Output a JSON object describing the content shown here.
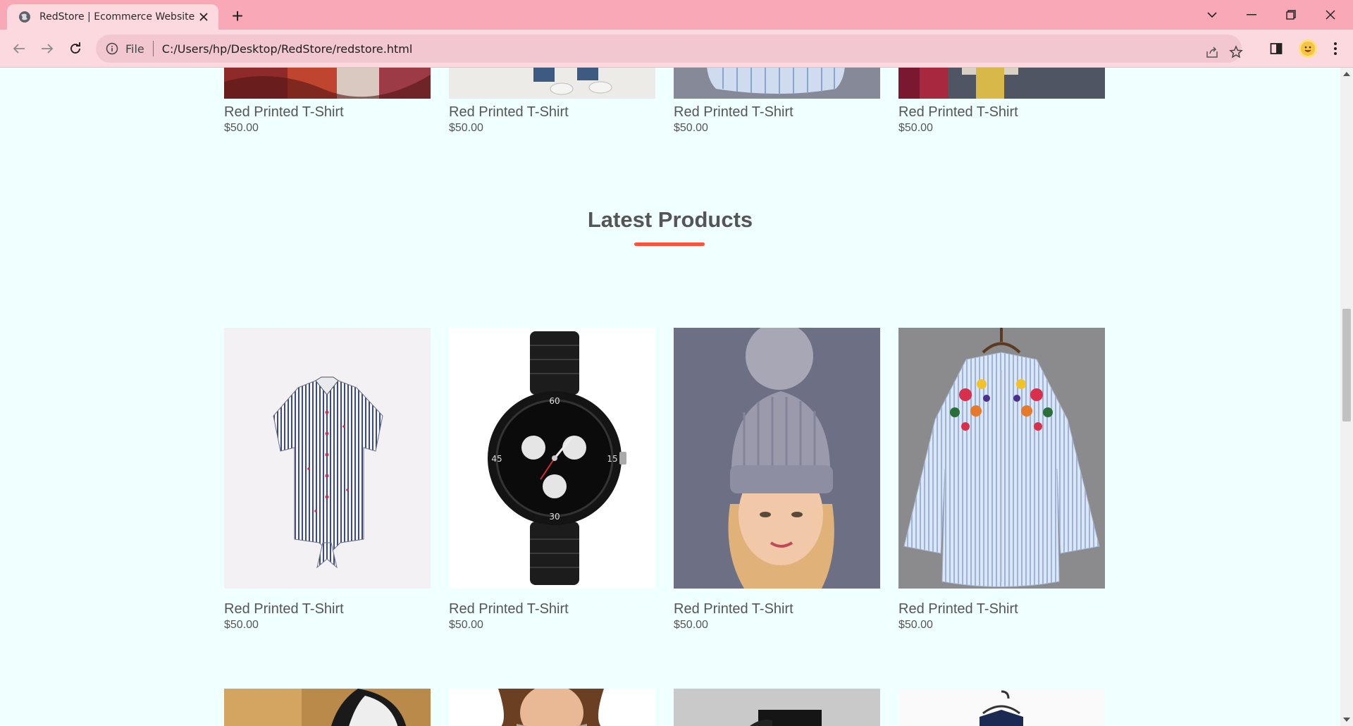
{
  "browser": {
    "tab_title": "RedStore | Ecommerce Website D",
    "new_tab_label": "+",
    "address_scheme": "File",
    "address_url": "C:/Users/hp/Desktop/RedStore/redstore.html"
  },
  "page": {
    "top_products": [
      {
        "title": "Red Printed T-Shirt",
        "price": "$50.00"
      },
      {
        "title": "Red Printed T-Shirt",
        "price": "$50.00"
      },
      {
        "title": "Red Printed T-Shirt",
        "price": "$50.00"
      },
      {
        "title": "Red Printed T-Shirt",
        "price": "$50.00"
      }
    ],
    "latest_title": "Latest Products",
    "latest_products": [
      {
        "title": "Red Printed T-Shirt",
        "price": "$50.00"
      },
      {
        "title": "Red Printed T-Shirt",
        "price": "$50.00"
      },
      {
        "title": "Red Printed T-Shirt",
        "price": "$50.00"
      },
      {
        "title": "Red Printed T-Shirt",
        "price": "$50.00"
      }
    ]
  },
  "colors": {
    "page_bg": "#f0ffff",
    "accent": "#ff523b",
    "browser_frame": "#f9a8b8",
    "browser_toolbar": "#fbd9df"
  },
  "icons": [
    "globe-icon",
    "close-icon",
    "plus-icon",
    "back-icon",
    "forward-icon",
    "reload-icon",
    "info-icon",
    "share-icon",
    "star-icon",
    "sidebar-icon",
    "profile-avatar-icon",
    "menu-icon",
    "chevron-down-icon",
    "minimize-icon",
    "restore-icon",
    "window-close-icon"
  ]
}
